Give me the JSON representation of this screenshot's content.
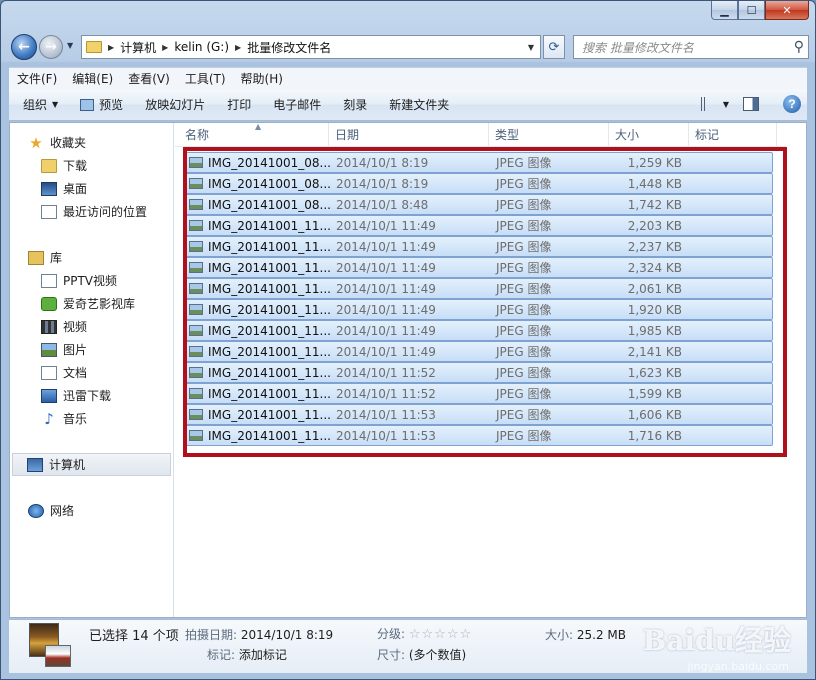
{
  "breadcrumb": {
    "items": [
      "计算机",
      "kelin (G:)",
      "批量修改文件名"
    ]
  },
  "search": {
    "placeholder": "搜索 批量修改文件名"
  },
  "menubar": {
    "items": [
      "文件(F)",
      "编辑(E)",
      "查看(V)",
      "工具(T)",
      "帮助(H)"
    ]
  },
  "toolbar": {
    "organize": "组织",
    "preview": "预览",
    "slideshow": "放映幻灯片",
    "print": "打印",
    "email": "电子邮件",
    "burn": "刻录",
    "new_folder": "新建文件夹"
  },
  "nav": {
    "favorites": {
      "label": "收藏夹",
      "items": [
        "下载",
        "桌面",
        "最近访问的位置"
      ]
    },
    "libraries": {
      "label": "库",
      "items": [
        "PPTV视频",
        "爱奇艺影视库",
        "视频",
        "图片",
        "文档",
        "迅雷下载",
        "音乐"
      ]
    },
    "computer": "计算机",
    "network": "网络"
  },
  "columns": {
    "name": "名称",
    "date": "日期",
    "type": "类型",
    "size": "大小",
    "tags": "标记"
  },
  "files": [
    {
      "name": "IMG_20141001_08...",
      "date": "2014/10/1 8:19",
      "type": "JPEG 图像",
      "size": "1,259 KB"
    },
    {
      "name": "IMG_20141001_08...",
      "date": "2014/10/1 8:19",
      "type": "JPEG 图像",
      "size": "1,448 KB"
    },
    {
      "name": "IMG_20141001_08...",
      "date": "2014/10/1 8:48",
      "type": "JPEG 图像",
      "size": "1,742 KB"
    },
    {
      "name": "IMG_20141001_11...",
      "date": "2014/10/1 11:49",
      "type": "JPEG 图像",
      "size": "2,203 KB"
    },
    {
      "name": "IMG_20141001_11...",
      "date": "2014/10/1 11:49",
      "type": "JPEG 图像",
      "size": "2,237 KB"
    },
    {
      "name": "IMG_20141001_11...",
      "date": "2014/10/1 11:49",
      "type": "JPEG 图像",
      "size": "2,324 KB"
    },
    {
      "name": "IMG_20141001_11...",
      "date": "2014/10/1 11:49",
      "type": "JPEG 图像",
      "size": "2,061 KB"
    },
    {
      "name": "IMG_20141001_11...",
      "date": "2014/10/1 11:49",
      "type": "JPEG 图像",
      "size": "1,920 KB"
    },
    {
      "name": "IMG_20141001_11...",
      "date": "2014/10/1 11:49",
      "type": "JPEG 图像",
      "size": "1,985 KB"
    },
    {
      "name": "IMG_20141001_11...",
      "date": "2014/10/1 11:49",
      "type": "JPEG 图像",
      "size": "2,141 KB"
    },
    {
      "name": "IMG_20141001_11...",
      "date": "2014/10/1 11:52",
      "type": "JPEG 图像",
      "size": "1,623 KB"
    },
    {
      "name": "IMG_20141001_11...",
      "date": "2014/10/1 11:52",
      "type": "JPEG 图像",
      "size": "1,599 KB"
    },
    {
      "name": "IMG_20141001_11...",
      "date": "2014/10/1 11:53",
      "type": "JPEG 图像",
      "size": "1,606 KB"
    },
    {
      "name": "IMG_20141001_11...",
      "date": "2014/10/1 11:53",
      "type": "JPEG 图像",
      "size": "1,716 KB"
    }
  ],
  "details": {
    "selected": "已选择 14 个项",
    "date_taken_label": "拍摄日期:",
    "date_taken": "2014/10/1 8:19",
    "tags_label": "标记:",
    "tags_value": "添加标记",
    "rating_label": "分级:",
    "rating_stars": "☆☆☆☆☆",
    "dimensions_label": "尺寸:",
    "dimensions_value": "(多个数值)",
    "size_label": "大小:",
    "size_value": "25.2 MB"
  },
  "watermark": {
    "logo": "Baidu经验",
    "url": "jingyan.baidu.com"
  },
  "colors": {
    "highlight_border": "#b0101b",
    "selection": "#c7def7"
  }
}
